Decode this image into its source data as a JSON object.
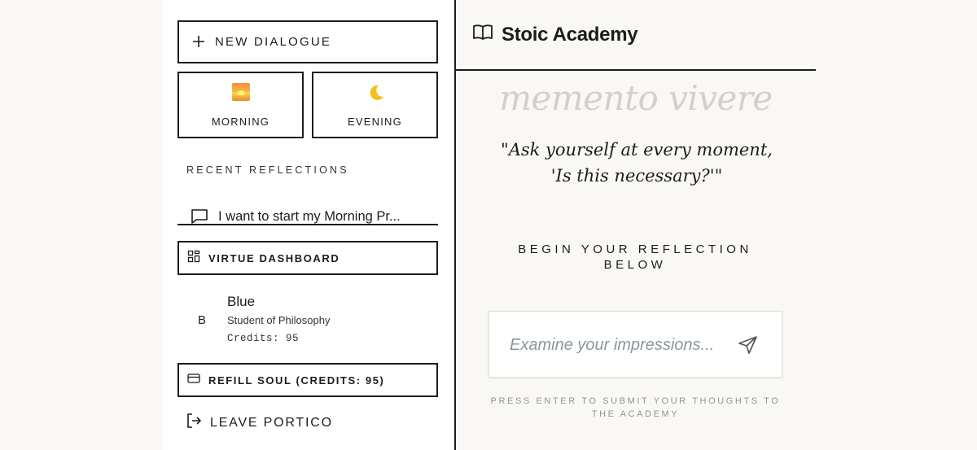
{
  "sidebar": {
    "new_dialogue_label": "NEW DIALOGUE",
    "modes": [
      {
        "label": "MORNING",
        "icon": "sunrise-icon"
      },
      {
        "label": "EVENING",
        "icon": "crescent-moon-icon"
      }
    ],
    "recent_title": "RECENT REFLECTIONS",
    "recent_items": [
      {
        "label": "I want to start my Morning Pr..."
      }
    ],
    "dashboard_label": "VIRTUE DASHBOARD",
    "user": {
      "initial": "B",
      "name": "Blue",
      "role": "Student of Philosophy",
      "credits": "Credits: 95"
    },
    "refill_label": "REFILL SOUL (CREDITS: 95)",
    "leave_label": "LEAVE PORTICO"
  },
  "header": {
    "title": "Stoic Academy",
    "icon": "book-open-icon"
  },
  "main": {
    "motto": "memento vivere",
    "quote": "\"Ask yourself at every moment, 'Is this necessary?'\"",
    "prompt": "BEGIN YOUR REFLECTION BELOW",
    "input_placeholder": "Examine your impressions...",
    "hint": "PRESS ENTER TO SUBMIT YOUR THOUGHTS TO THE ACADEMY"
  },
  "colors": {
    "background": "#fbf9f6",
    "ink": "#1c1c1c",
    "muted_motto": "#d3d0cb",
    "placeholder": "#8a95a1"
  }
}
